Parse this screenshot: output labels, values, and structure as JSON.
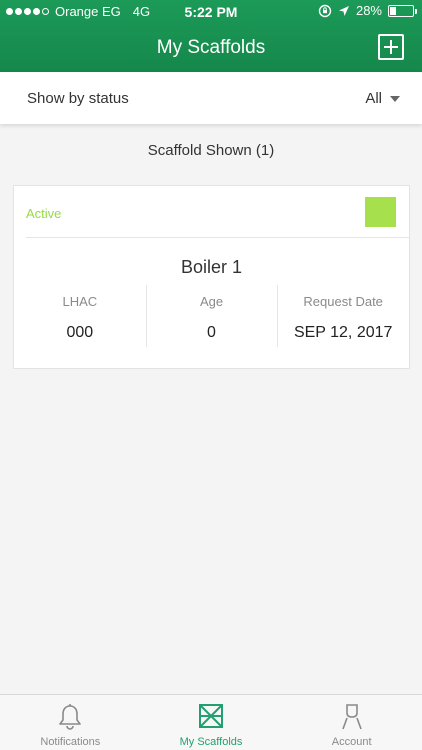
{
  "status_bar": {
    "carrier": "Orange EG",
    "network": "4G",
    "time": "5:22 PM",
    "battery": "28%",
    "battery_level": 0.28
  },
  "nav": {
    "title": "My Scaffolds",
    "add_icon": "plus-square-icon"
  },
  "filter": {
    "label": "Show by status",
    "selected": "All"
  },
  "summary": {
    "shown_text": "Scaffold Shown (1)"
  },
  "cards": [
    {
      "status": "Active",
      "status_color": "#a6e04c",
      "title": "Boiler 1",
      "columns": [
        {
          "label": "LHAC",
          "value": "000"
        },
        {
          "label": "Age",
          "value": "0"
        },
        {
          "label": "Request Date",
          "value": "SEP 12, 2017"
        }
      ]
    }
  ],
  "tabs": [
    {
      "label": "Notifications",
      "icon": "bell-icon",
      "active": false
    },
    {
      "label": "My Scaffolds",
      "icon": "scaffold-icon",
      "active": true
    },
    {
      "label": "Account",
      "icon": "person-icon",
      "active": false
    }
  ],
  "colors": {
    "header_green": "#1c9a58",
    "active_tab": "#22a070",
    "status_active": "#94dd3e"
  }
}
